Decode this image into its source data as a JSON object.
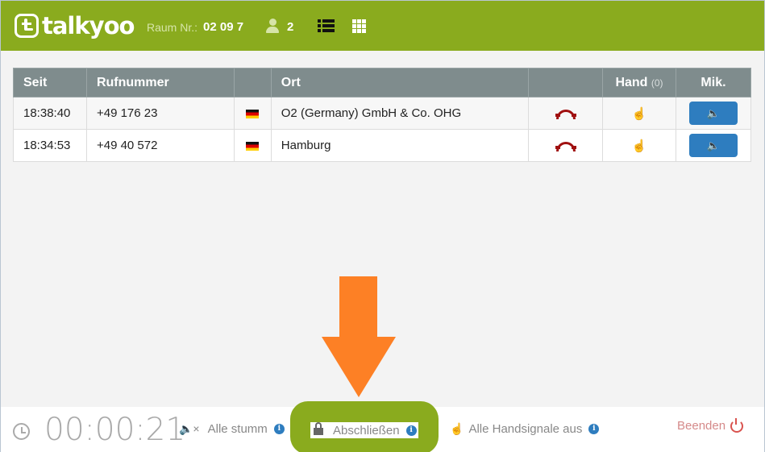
{
  "header": {
    "logo_text": "talkyoo",
    "room_label": "Raum Nr.:",
    "room_number": "02 09 7",
    "participant_count": "2",
    "brand_color": "#8aab1e"
  },
  "table": {
    "columns": [
      "Seit",
      "Rufnummer",
      "",
      "Ort",
      "",
      "Hand",
      "Mik."
    ],
    "hand_count": "(0)",
    "rows": [
      {
        "since": "18:38:40",
        "number": "+49 176 23",
        "flag": "germany-flag",
        "location": "O2 (Germany) GmbH & Co. OHG"
      },
      {
        "since": "18:34:53",
        "number": "+49 40 572",
        "flag": "germany-flag",
        "location": "Hamburg"
      }
    ],
    "mic_icon": "🔈",
    "hand_icon": "☝"
  },
  "footer": {
    "timer": "00:00:21",
    "mute_all": "Alle stumm",
    "lock": "Abschließen",
    "hands_off": "Alle Handsignale aus",
    "end": "Beenden",
    "info_glyph": "i",
    "mute_icon_glyph": "🔈×",
    "hand_off_icon_glyph": "☝"
  },
  "annotation": {
    "arrow_color": "#fd8025",
    "highlight_color": "#8aab1e"
  }
}
